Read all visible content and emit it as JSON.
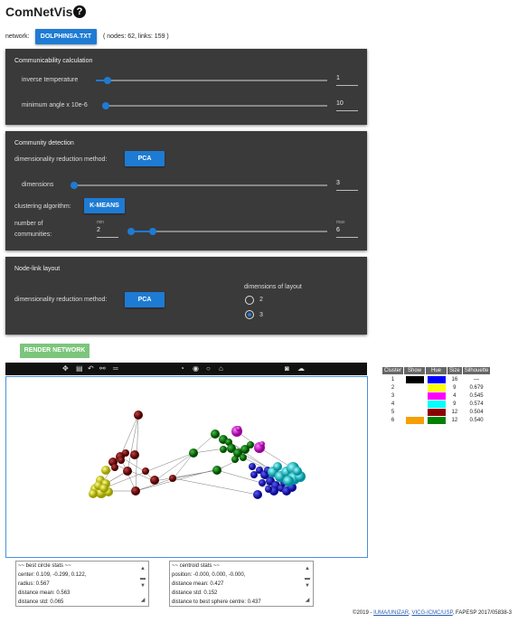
{
  "app": {
    "title": "ComNetVis",
    "help_glyph": "?"
  },
  "network": {
    "label": "network:",
    "file_button": "DOLPHINSA.TXT",
    "info": "( nodes: 62, links: 159 )"
  },
  "communicability": {
    "header": "Communicability calculation",
    "inverse_temperature": {
      "label": "inverse temperature",
      "value": "1",
      "level": 0.05
    },
    "min_angle": {
      "label": "minimum angle x 10e-6",
      "value": "10",
      "level": 0.0
    }
  },
  "community": {
    "header": "Community detection",
    "dim_reduction_label": "dimensionality reduction method:",
    "dim_reduction_button": "PCA",
    "dimensions": {
      "label": "dimensions",
      "value": "3",
      "level": 0.0
    },
    "clustering_label": "clustering algorithm:",
    "clustering_button": "K-MEANS",
    "num_communities": {
      "label_line1": "number of",
      "label_line2": "communities:",
      "min_caption": "min",
      "min_value": "2",
      "max_caption": "max",
      "max_value": "6",
      "range": [
        0.0,
        0.11
      ]
    }
  },
  "nodelink": {
    "header": "Node-link layout",
    "dim_reduction_label": "dimensionality reduction method:",
    "dim_reduction_button": "PCA",
    "dims_label": "dimensions of layout",
    "options": [
      {
        "label": "2",
        "checked": false
      },
      {
        "label": "3",
        "checked": true
      }
    ]
  },
  "render_button": "RENDER NETWORK",
  "toolbar_icons": [
    "move-icon",
    "zoom-box-icon",
    "undo-icon",
    "link-icon",
    "menu-icon",
    "compass-icon",
    "target-icon",
    "circle-icon",
    "home-icon",
    "camera-icon",
    "cloud-upload-icon"
  ],
  "cluster_table": {
    "headers": [
      "Cluster",
      "Show",
      "Hue",
      "Size",
      "Silhouette"
    ],
    "rows": [
      {
        "cluster": "1",
        "show_color": "#000000",
        "hue_color": "#0000ff",
        "size": "16",
        "silhouette": "—"
      },
      {
        "cluster": "2",
        "show_color": "",
        "hue_color": "#ffff00",
        "size": "9",
        "silhouette": "0.679"
      },
      {
        "cluster": "3",
        "show_color": "",
        "hue_color": "#ff00ff",
        "size": "4",
        "silhouette": "0.545"
      },
      {
        "cluster": "4",
        "show_color": "",
        "hue_color": "#00ffff",
        "size": "9",
        "silhouette": "0.574"
      },
      {
        "cluster": "5",
        "show_color": "",
        "hue_color": "#8b0000",
        "size": "12",
        "silhouette": "0.504"
      },
      {
        "cluster": "6",
        "show_color": "#f5a000",
        "hue_color": "#008000",
        "size": "12",
        "silhouette": "0.540"
      }
    ]
  },
  "stats": {
    "circle_lines": [
      "~~ best circle stats ~~",
      "center: 0.109, -0.299, 0.122,",
      "radius: 0.567",
      "distance mean: 0.563",
      "distance std: 0.065"
    ],
    "centroid_lines": [
      "~~ centroid stats ~~",
      "position: -0.000, 0.000, -0.000,",
      "distance mean: 0.427",
      "distance std: 0.152",
      "distance to best sphere centre: 0.437"
    ]
  },
  "footer": {
    "prefix": "©2019 - ",
    "link1": "IUMA/UNIZAR",
    "sep": ", ",
    "link2": "VICG-ICMC/USP",
    "suffix": ", FAPESP 2017/05838-3"
  },
  "colors": {
    "accent": "#1e7bd4",
    "panel": "#3a3a3a",
    "render": "#7cc57c"
  }
}
